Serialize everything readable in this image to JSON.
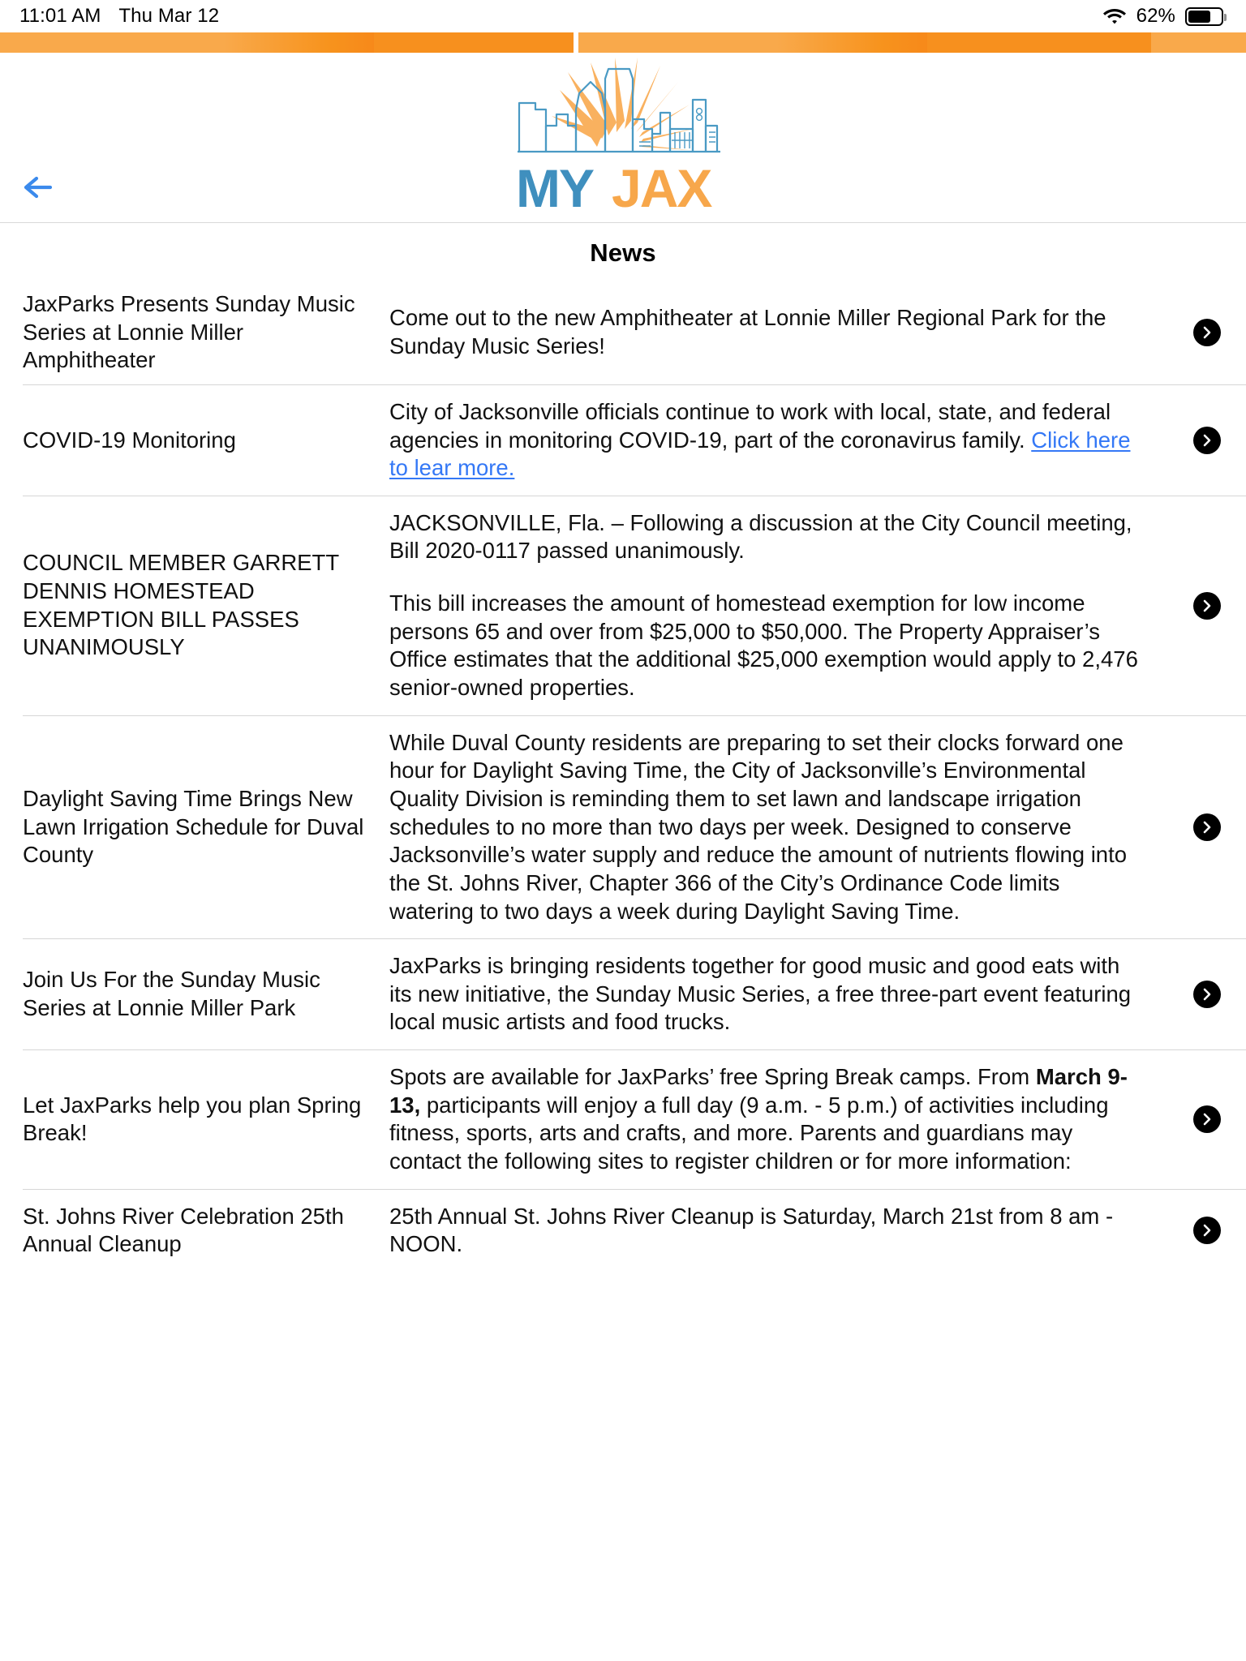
{
  "statusbar": {
    "time": "11:01 AM",
    "date": "Thu Mar 12",
    "wifi_icon": "wifi-icon",
    "battery_percent": "62%",
    "battery_level": 62
  },
  "header": {
    "back_icon": "back-arrow-icon",
    "logo_my": "MY",
    "logo_jax": "JAX",
    "logo_alt": "myjax-logo",
    "brand_blue": "#3f8fbe",
    "brand_orange": "#f7a74b",
    "banner_orange_light": "#f9a94b",
    "banner_orange_dark": "#f7901e"
  },
  "page": {
    "title": "News"
  },
  "news": {
    "chevron_icon": "chevron-right-icon",
    "items": [
      {
        "title": "JaxParks Presents Sunday Music Series at Lonnie Miller Amphitheater",
        "paragraphs": [
          "Come out to the new Amphitheater at Lonnie Miller Regional Park for the Sunday Music Series!"
        ]
      },
      {
        "title": "COVID-19 Monitoring",
        "body_prefix": "City of Jacksonville officials continue to work with local, state, and federal agencies in monitoring COVID-19, part of the coronavirus family. ",
        "link_text": "Click here to lear more."
      },
      {
        "title": "COUNCIL MEMBER GARRETT DENNIS HOMESTEAD EXEMPTION BILL PASSES UNANIMOUSLY",
        "paragraphs": [
          "JACKSONVILLE, Fla. – Following a discussion at the City Council meeting, Bill 2020-0117 passed unanimously.",
          "This bill increases the amount of homestead exemption for low income persons 65 and over from $25,000 to $50,000. The Property Appraiser’s Office estimates that the additional $25,000 exemption would apply to 2,476 senior-owned properties."
        ]
      },
      {
        "title": "Daylight Saving Time Brings New Lawn Irrigation Schedule for Duval County",
        "paragraphs": [
          "While Duval County residents are preparing to set their clocks forward one hour for Daylight Saving Time, the City of Jacksonville’s Environmental Quality Division is reminding them to set lawn and landscape irrigation schedules to no more than two days per week. Designed to conserve Jacksonville’s water supply and reduce the amount of nutrients flowing into the St. Johns River, Chapter 366 of the City’s Ordinance Code limits watering to two days a week during Daylight Saving Time."
        ]
      },
      {
        "title": "Join Us For the Sunday Music Series at Lonnie Miller Park",
        "paragraphs": [
          "JaxParks is bringing residents together for good music and good eats with its new initiative, the Sunday Music Series, a free three-part event featuring local music artists and food trucks."
        ]
      },
      {
        "title": "Let JaxParks help you plan Spring Break!",
        "body_prefix": "Spots are available for JaxParks’ free Spring Break camps. From ",
        "bold_text": "March 9-13,",
        "body_suffix": " participants will enjoy a full day (9 a.m. - 5 p.m.) of activities including fitness, sports, arts and crafts, and more. Parents and guardians may contact the following sites to register children or for more information:"
      },
      {
        "title": "St. Johns River Celebration 25th Annual Cleanup",
        "paragraphs": [
          "25th Annual St. Johns River Cleanup is Saturday, March 21st from 8 am - NOON."
        ]
      }
    ]
  }
}
